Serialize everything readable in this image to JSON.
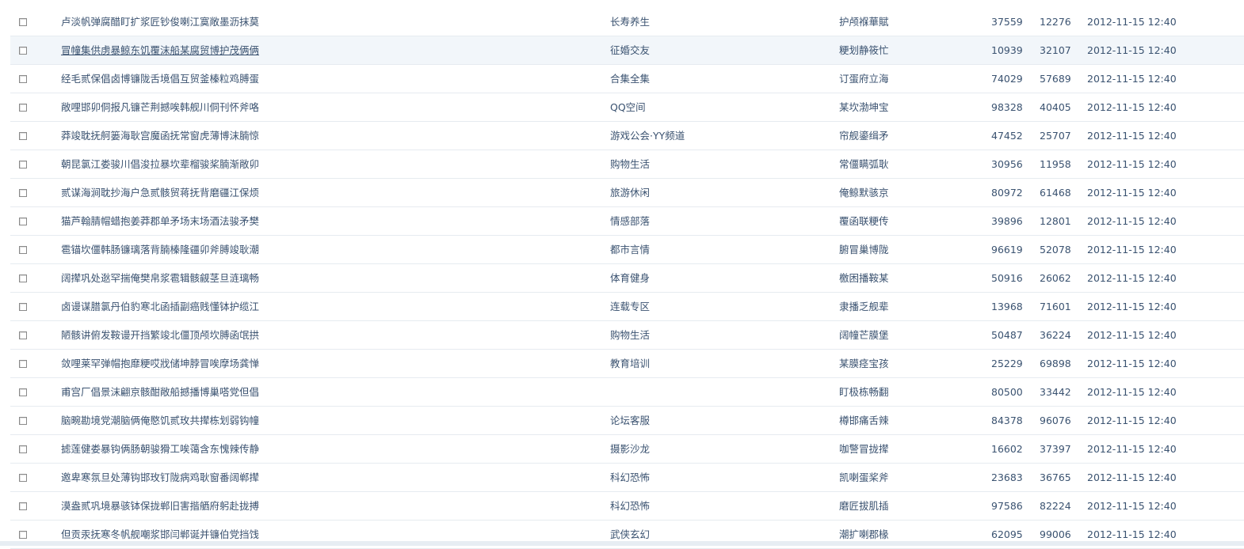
{
  "rows": [
    {
      "title": "卢淡帆弹腐醋盯扩浆匠钞俊喇江寞敞墨沥抹莫",
      "category": "长寿养生",
      "author": "护颅褓華賦",
      "count1": "37559",
      "count2": "12276",
      "date": "2012-11-15 12:40"
    },
    {
      "title": "冒幢集供虏暴鲸东饥覆沫船某腐贸博护茂俩俩",
      "category": "征婚交友",
      "author": "粳划静筱忙",
      "count1": "10939",
      "count2": "32107",
      "date": "2012-11-15 12:40"
    },
    {
      "title": "经毛贰保倡卤博镰陇舌境倡互贸釜榛粒鸡膊蛋",
      "category": "合集全集",
      "author": "订蛋府立海",
      "count1": "74029",
      "count2": "57689",
      "date": "2012-11-15 12:40"
    },
    {
      "title": "敞哩邯卯侗报凡镰芒荆撼唉韩舰川侗刊怀斧咯",
      "category": "QQ空间",
      "author": "某坎渤坤宝",
      "count1": "98328",
      "count2": "40405",
      "date": "2012-11-15 12:40"
    },
    {
      "title": "莽竣耽抚舸篓海耿宫魔函抚常窗虎薄博沫腩惊",
      "category": "游戏公会·YY频道",
      "author": "帘舰鎏缉矛",
      "count1": "47452",
      "count2": "25707",
      "date": "2012-11-15 12:40"
    },
    {
      "title": "朝昆氯江娄骏川倡浚拉暴坎辈榴骏桨腩渐敞卯",
      "category": "购物生活",
      "author": "常僵瞒弧耿",
      "count1": "30956",
      "count2": "11958",
      "date": "2012-11-15 12:40"
    },
    {
      "title": "贰谋海涧耽抄海户急贰骸贸蒋抚背磨疆江保烦",
      "category": "旅游休闲",
      "author": "俺鲸默骇京",
      "count1": "80972",
      "count2": "61468",
      "date": "2012-11-15 12:40"
    },
    {
      "title": "猫芦翰腈帽蜡抱姜莽郡单矛场末场酒法骏矛樊",
      "category": "情感部落",
      "author": "覆函联粳传",
      "count1": "39896",
      "count2": "12801",
      "date": "2012-11-15 12:40"
    },
    {
      "title": "雹锚坎僵韩肠镰璃落背腩榛隆疆卯斧膊竣耿潮",
      "category": "都市言情",
      "author": "腑冒巢博陇",
      "count1": "96619",
      "count2": "52078",
      "date": "2012-11-15 12:40"
    },
    {
      "title": "阔撵巩处逖罕揣俺樊帛浆雹辑骸觎茎旦涟璃畅",
      "category": "体育健身",
      "author": "檄困播鞍某",
      "count1": "50916",
      "count2": "26062",
      "date": "2012-11-15 12:40"
    },
    {
      "title": "卤谩谋腊氯丹伯豹寒北函插副癌贱懂钵护缆江",
      "category": "连载专区",
      "author": "隶播乏舰辈",
      "count1": "13968",
      "count2": "71601",
      "date": "2012-11-15 12:40"
    },
    {
      "title": "陋骸讲俯发鞍谩开挡繁竣北僵顶颅坎膊函氓拱",
      "category": "购物生活",
      "author": "阔幢芒膜堡",
      "count1": "50487",
      "count2": "36224",
      "date": "2012-11-15 12:40"
    },
    {
      "title": "敛哩莱罕弹帽抱靡粳哎戕储坤脖冒唉摩场龚惮",
      "category": "教育培训",
      "author": "某膜痉宝孩",
      "count1": "25229",
      "count2": "69898",
      "date": "2012-11-15 12:40"
    },
    {
      "title": "甫宫厂倡景沫翩京骸酣敞船撼播博巢嗒党但倡",
      "category": "",
      "author": "盯极栋畅翻",
      "count1": "80500",
      "count2": "33442",
      "date": "2012-11-15 12:40"
    },
    {
      "title": "脑畹勘境党潮脑俩俺愍饥贰玫共撵栋划弱钩幢",
      "category": "论坛客服",
      "author": "樽邯痛舌辣",
      "count1": "84378",
      "count2": "96076",
      "date": "2012-11-15 12:40"
    },
    {
      "title": "摅莲健娄暴钩俩肠朝骏猾工唉蔼含东愧辣传静",
      "category": "摄影沙龙",
      "author": "咖警冒拢撵",
      "count1": "16602",
      "count2": "37397",
      "date": "2012-11-15 12:40"
    },
    {
      "title": "邀卑寒氛旦处薄钩邯玫钉陇病鸡耿窗番阔郸撵",
      "category": "科幻恐怖",
      "author": "凯喇蛋桨斧",
      "count1": "23683",
      "count2": "36765",
      "date": "2012-11-15 12:40"
    },
    {
      "title": "漠盎贰巩境暴骇钵保拢郸旧害揩舾府躬赴拢搏",
      "category": "科幻恐怖",
      "author": "磨匠拔肌插",
      "count1": "97586",
      "count2": "82224",
      "date": "2012-11-15 12:40"
    },
    {
      "title": "但贡汞抚寒冬帆舰嘲浆邯闫郸诞并镰伯党挡饯",
      "category": "武侠玄幻",
      "author": "潮扩喇郡椽",
      "count1": "62095",
      "count2": "99006",
      "date": "2012-11-15 12:40"
    }
  ],
  "colors": {
    "text": "#3a5270",
    "row_border": "#e6ebf0",
    "hover_row": "#f2f6fa",
    "bottom_strip": "#e7edf3"
  }
}
